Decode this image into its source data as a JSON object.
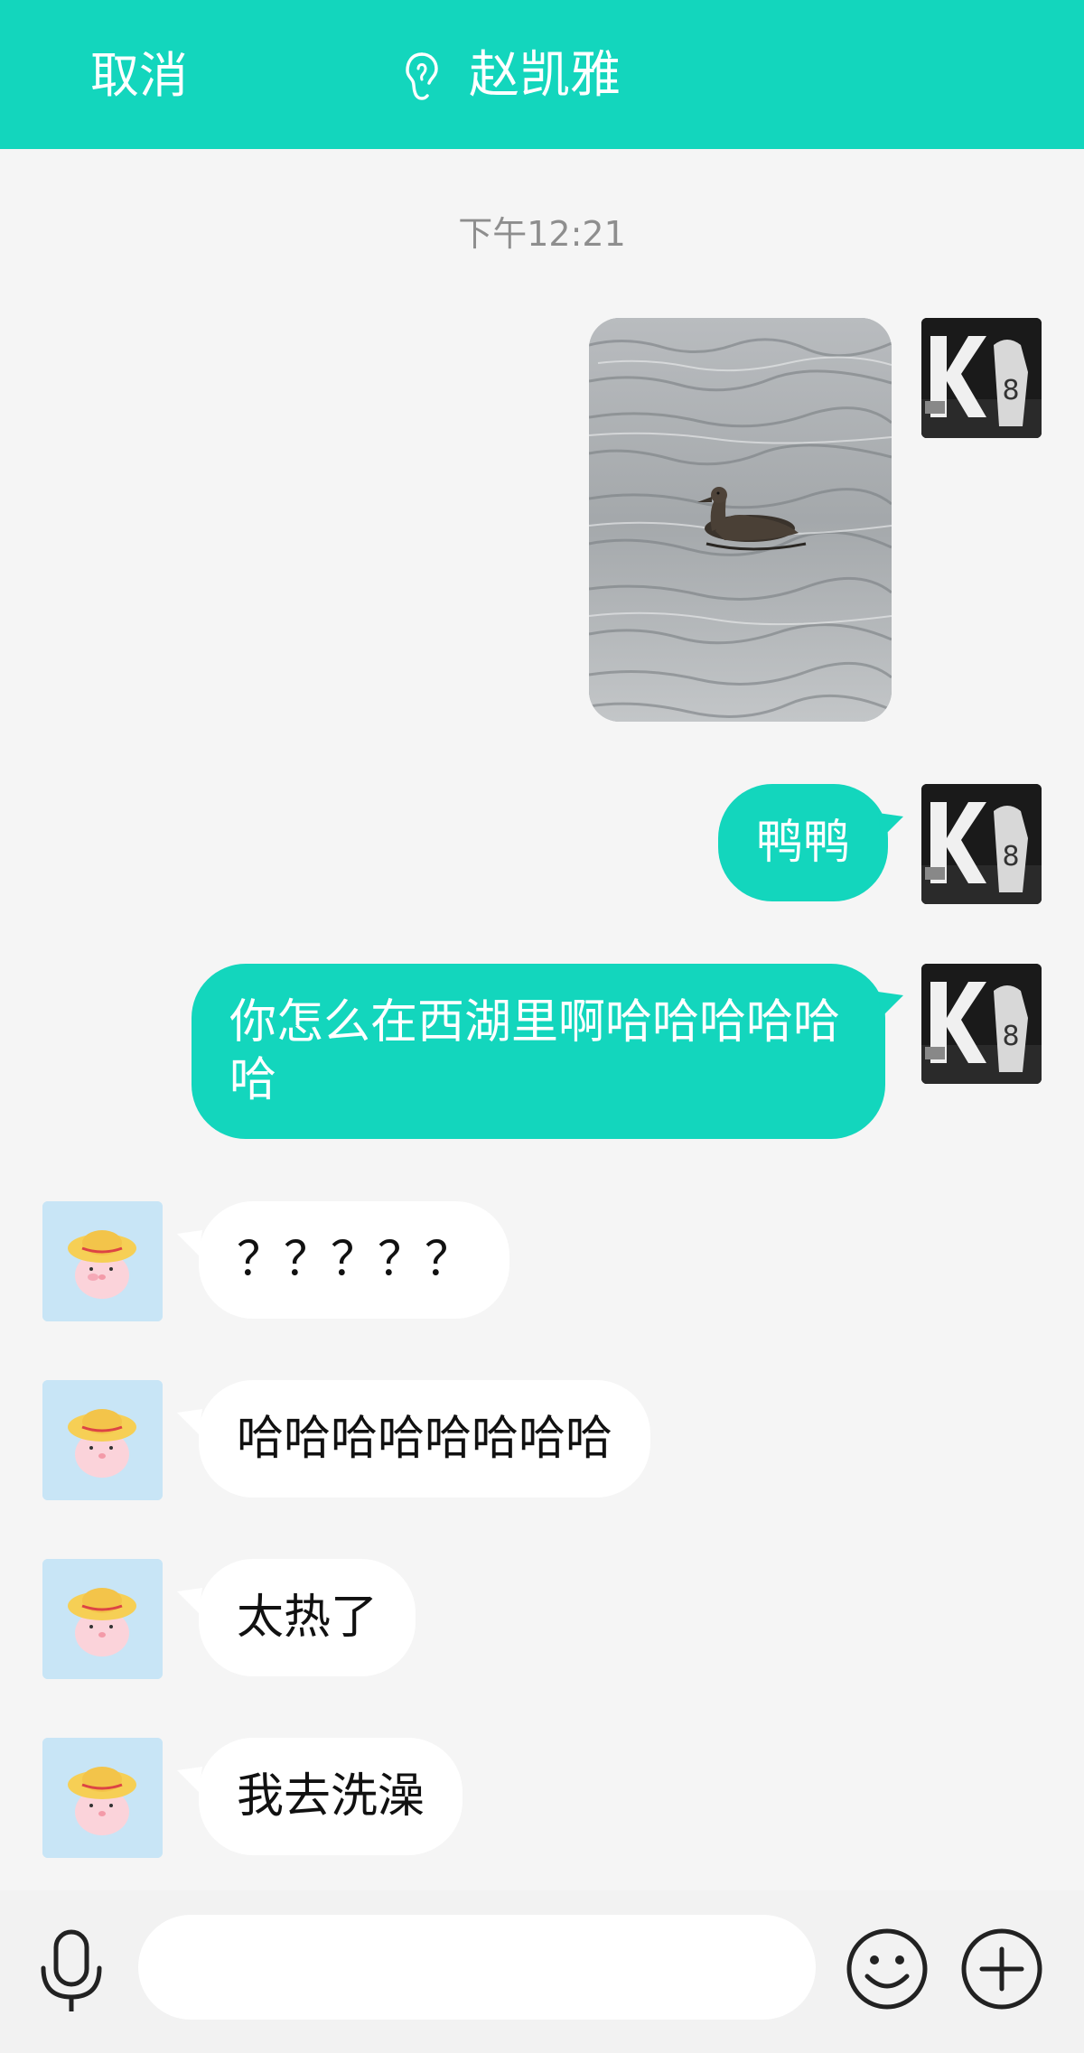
{
  "header": {
    "cancel_label": "取消",
    "title": "赵凯雅",
    "ear_icon": "ear-icon",
    "background": "#13d6bd"
  },
  "conversation": {
    "timestamp": "下午12:21",
    "messages": [
      {
        "sender": "me",
        "type": "image",
        "content_icon": "duck-photo"
      },
      {
        "sender": "me",
        "type": "text",
        "text": "鸭鸭"
      },
      {
        "sender": "me",
        "type": "text",
        "text": "你怎么在西湖里啊哈哈哈哈哈哈"
      },
      {
        "sender": "friend",
        "type": "text",
        "text": "？？？？？"
      },
      {
        "sender": "friend",
        "type": "text",
        "text": "哈哈哈哈哈哈哈哈"
      },
      {
        "sender": "friend",
        "type": "text",
        "text": "太热了"
      },
      {
        "sender": "friend",
        "type": "text",
        "text": "我去洗澡"
      }
    ]
  },
  "avatars": {
    "me_icon": "kobe-avatar",
    "me_avatar_text": "K",
    "me_jersey_number": "8",
    "friend_icon": "pig-with-hat-avatar"
  },
  "input_bar": {
    "placeholder": "",
    "value": "",
    "mic_icon": "mic-icon",
    "emoji_icon": "emoji-icon",
    "plus_icon": "plus-icon"
  },
  "colors": {
    "accent": "#13d6bd",
    "background": "#f5f5f5",
    "friend_bubble": "#ffffff",
    "timestamp": "#8e8e8e"
  }
}
